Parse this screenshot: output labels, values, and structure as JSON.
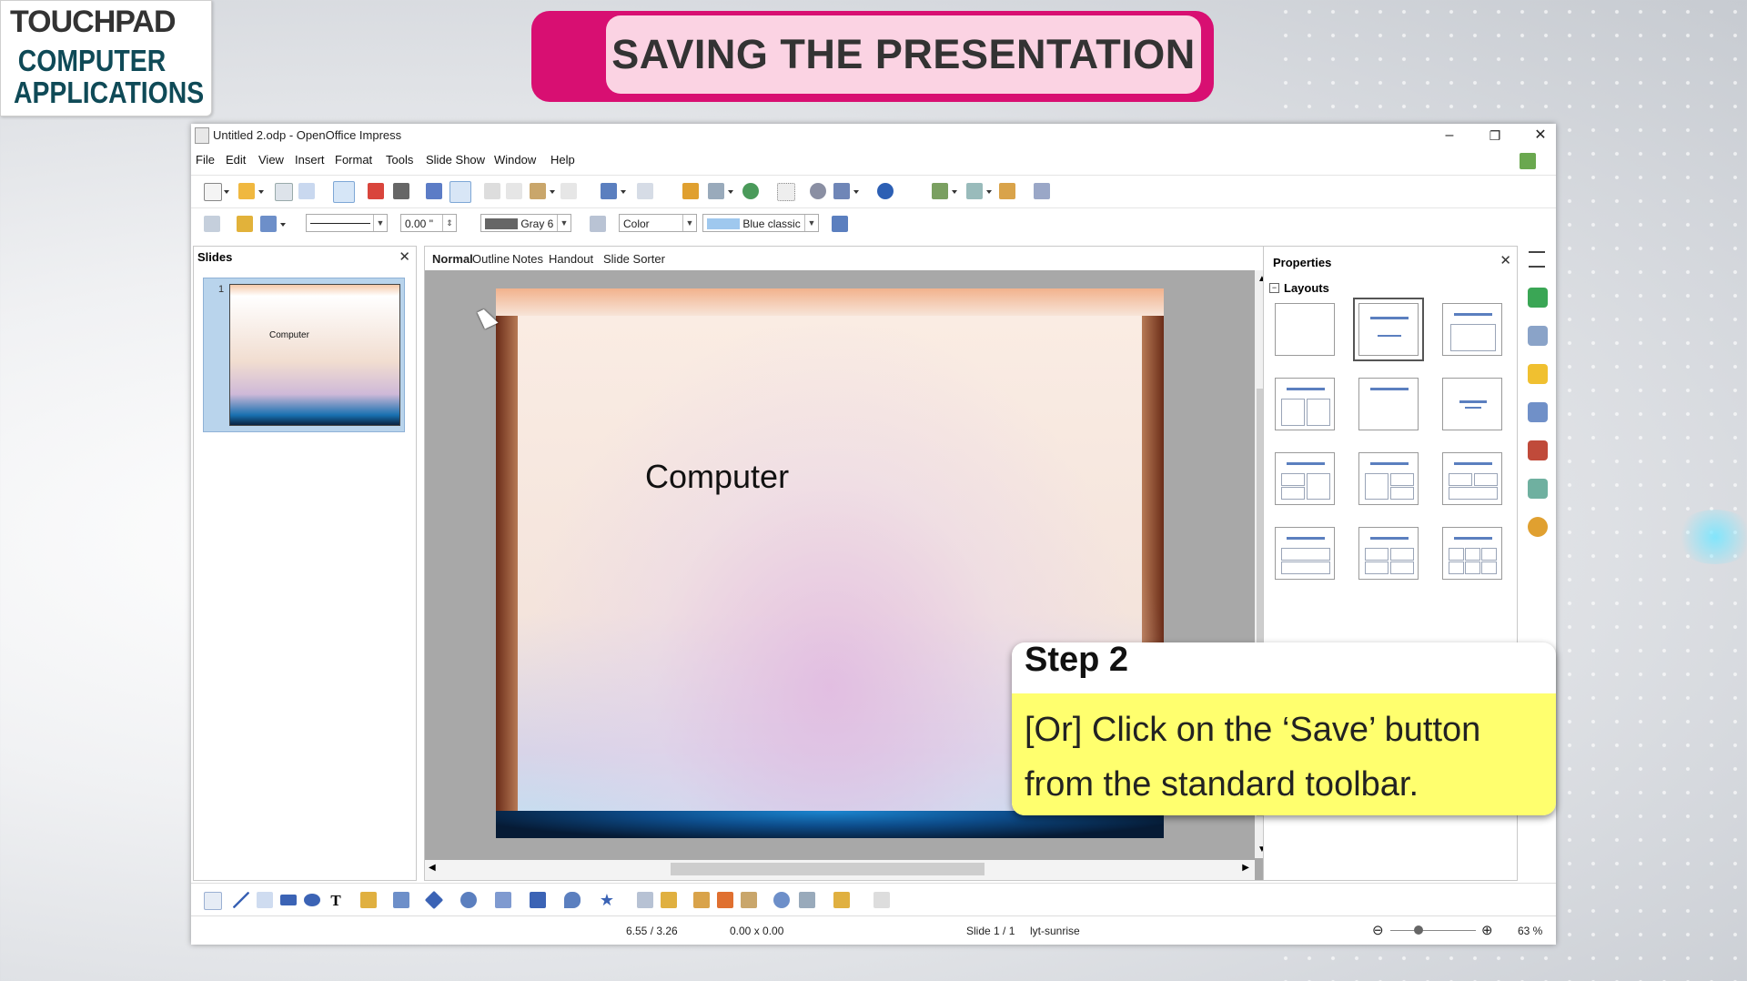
{
  "brand": {
    "top": "TOUCHPAD",
    "line1": "COMPUTER",
    "line2": "APPLICATIONS"
  },
  "banner": {
    "title": "SAVING THE PRESENTATION"
  },
  "window": {
    "title": "Untitled 2.odp - OpenOffice Impress",
    "controls": {
      "minimize": "–",
      "restore": "❐",
      "close": "✕"
    }
  },
  "menu": [
    "File",
    "Edit",
    "View",
    "Insert",
    "Format",
    "Tools",
    "Slide Show",
    "Window",
    "Help"
  ],
  "formatting_toolbar": {
    "line_width": "0.00 \"",
    "line_color": "Gray 6",
    "area_style": "Color",
    "area_color": "Blue classic"
  },
  "slides_pane": {
    "title": "Slides",
    "close": "✕",
    "thumbnail_number": "1",
    "thumbnail_text": "Computer"
  },
  "view_tabs": [
    "Normal",
    "Outline",
    "Notes",
    "Handout",
    "Slide Sorter"
  ],
  "slide": {
    "text": "Computer"
  },
  "properties": {
    "title": "Properties",
    "close": "✕",
    "section": "Layouts",
    "collapse": "−"
  },
  "status": {
    "position": "6.55 / 3.26",
    "size": "0.00 x 0.00",
    "slide": "Slide 1 / 1",
    "design": "lyt-sunrise",
    "zoom": "63 %",
    "zoom_minus": "⊖",
    "zoom_plus": "⊕"
  },
  "callout": {
    "title": "Step 2",
    "text": "[Or] Click on the ‘Save’ button from the standard toolbar."
  },
  "colors": {
    "banner": "#d80f72",
    "banner_inner": "#fbd3e3",
    "callout_body": "#ffff6e",
    "brand_text": "#0f4a57"
  }
}
